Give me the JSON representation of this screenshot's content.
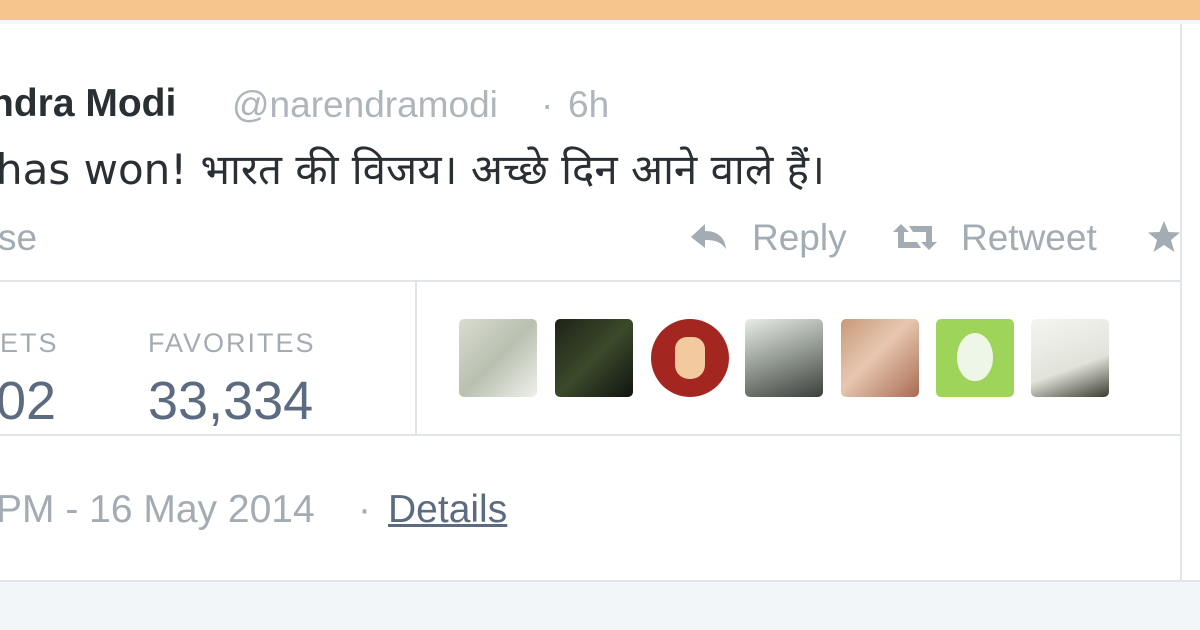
{
  "tweet": {
    "author_name": "ndra Modi",
    "handle": "@narendramodi",
    "separator": "·",
    "time_ago": "6h",
    "text": "has won! भारत की विजय। अच्छे दिन आने वाले हैं।"
  },
  "actions": {
    "collapse_label": "se",
    "reply_label": "Reply",
    "retweet_label": "Retweet"
  },
  "stats": {
    "retweets_label": "ETS",
    "retweets_value": "02",
    "favorites_label": "FAVORITES",
    "favorites_value": "33,334"
  },
  "favoriters": [
    {
      "icon": "avatar-sketch-image"
    },
    {
      "icon": "avatar-dark-photo"
    },
    {
      "icon": "avatar-victory-hand"
    },
    {
      "icon": "avatar-man-photo"
    },
    {
      "icon": "avatar-child-photo"
    },
    {
      "icon": "avatar-default-egg"
    },
    {
      "icon": "avatar-young-man-photo"
    }
  ],
  "meta": {
    "timestamp": "PM - 16 May 2014",
    "separator": "·",
    "details_link": "Details"
  },
  "colors": {
    "top_bar": "#f6c58e",
    "text_primary": "#292f33",
    "text_muted": "#a4acb3",
    "stat_value": "#5c6b80",
    "divider": "#e1e5e8"
  }
}
